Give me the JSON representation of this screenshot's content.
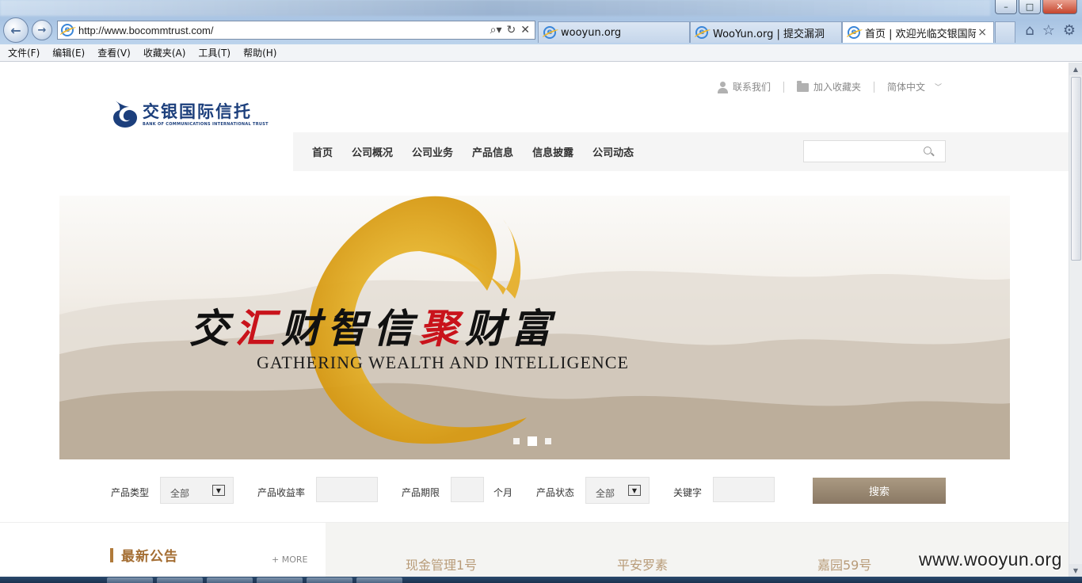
{
  "browser": {
    "address_url": "http://www.bocommtrust.com/",
    "tabs": [
      {
        "label": "wooyun.org"
      },
      {
        "label": "WooYun.org | 提交漏洞"
      },
      {
        "label": "首页 | 欢迎光临交银国际..."
      }
    ],
    "tab_close_glyph": "×",
    "menu": [
      "文件(F)",
      "编辑(E)",
      "查看(V)",
      "收藏夹(A)",
      "工具(T)",
      "帮助(H)"
    ]
  },
  "header": {
    "util_links": {
      "contact": "联系我们",
      "favorite": "加入收藏夹",
      "language": "简体中文"
    },
    "logo": {
      "cn": "交银国际信托",
      "en": "BANK OF COMMUNICATIONS INTERNATIONAL TRUST"
    },
    "nav": [
      "首页",
      "公司概况",
      "公司业务",
      "产品信息",
      "信息披露",
      "公司动态"
    ],
    "search_value": ""
  },
  "banner": {
    "title_parts": [
      "交",
      "汇",
      "财智信",
      "聚",
      "财富"
    ],
    "subtitle": "GATHERING WEALTH AND INTELLIGENCE",
    "slides": 3,
    "active_slide": 2
  },
  "filter": {
    "type_label": "产品类型",
    "type_value": "全部",
    "yield_label": "产品收益率",
    "term_label": "产品期限",
    "term_unit": "个月",
    "status_label": "产品状态",
    "status_value": "全部",
    "keyword_label": "关键字",
    "search_button": "搜索"
  },
  "news": {
    "title": "最新公告",
    "more": "+ MORE"
  },
  "products": [
    "现金管理1号",
    "平安罗素",
    "嘉园59号"
  ],
  "watermark": "www.wooyun.org",
  "colors": {
    "nav_text": "#333333",
    "brand_blue": "#1c3f7c",
    "accent_red": "#c9131b",
    "gold": "#e9b52a",
    "search_button": "#9c8a74",
    "news_title": "#a46e33"
  }
}
